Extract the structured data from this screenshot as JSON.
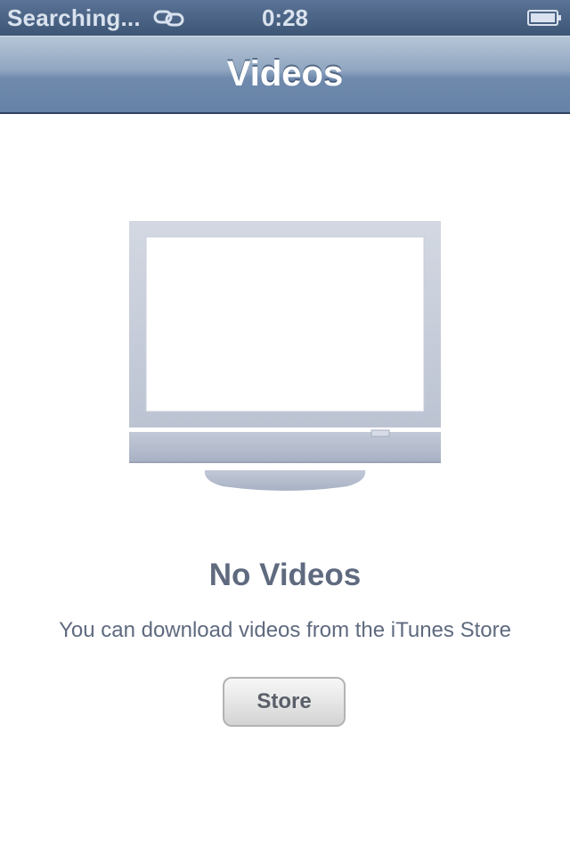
{
  "status_bar": {
    "carrier": "Searching...",
    "link_icon": "chain-link-icon",
    "time": "0:28",
    "battery_icon": "battery-icon"
  },
  "nav_bar": {
    "title": "Videos"
  },
  "empty_state": {
    "illustration": "tv-icon",
    "title": "No Videos",
    "message": "You can download videos from the iTunes Store",
    "store_button_label": "Store"
  },
  "colors": {
    "status_bar": "#4a6283",
    "nav_bar": "#7d96b6",
    "empty_text": "#5f6a7f",
    "tv_frame": "#c4cbd9"
  }
}
